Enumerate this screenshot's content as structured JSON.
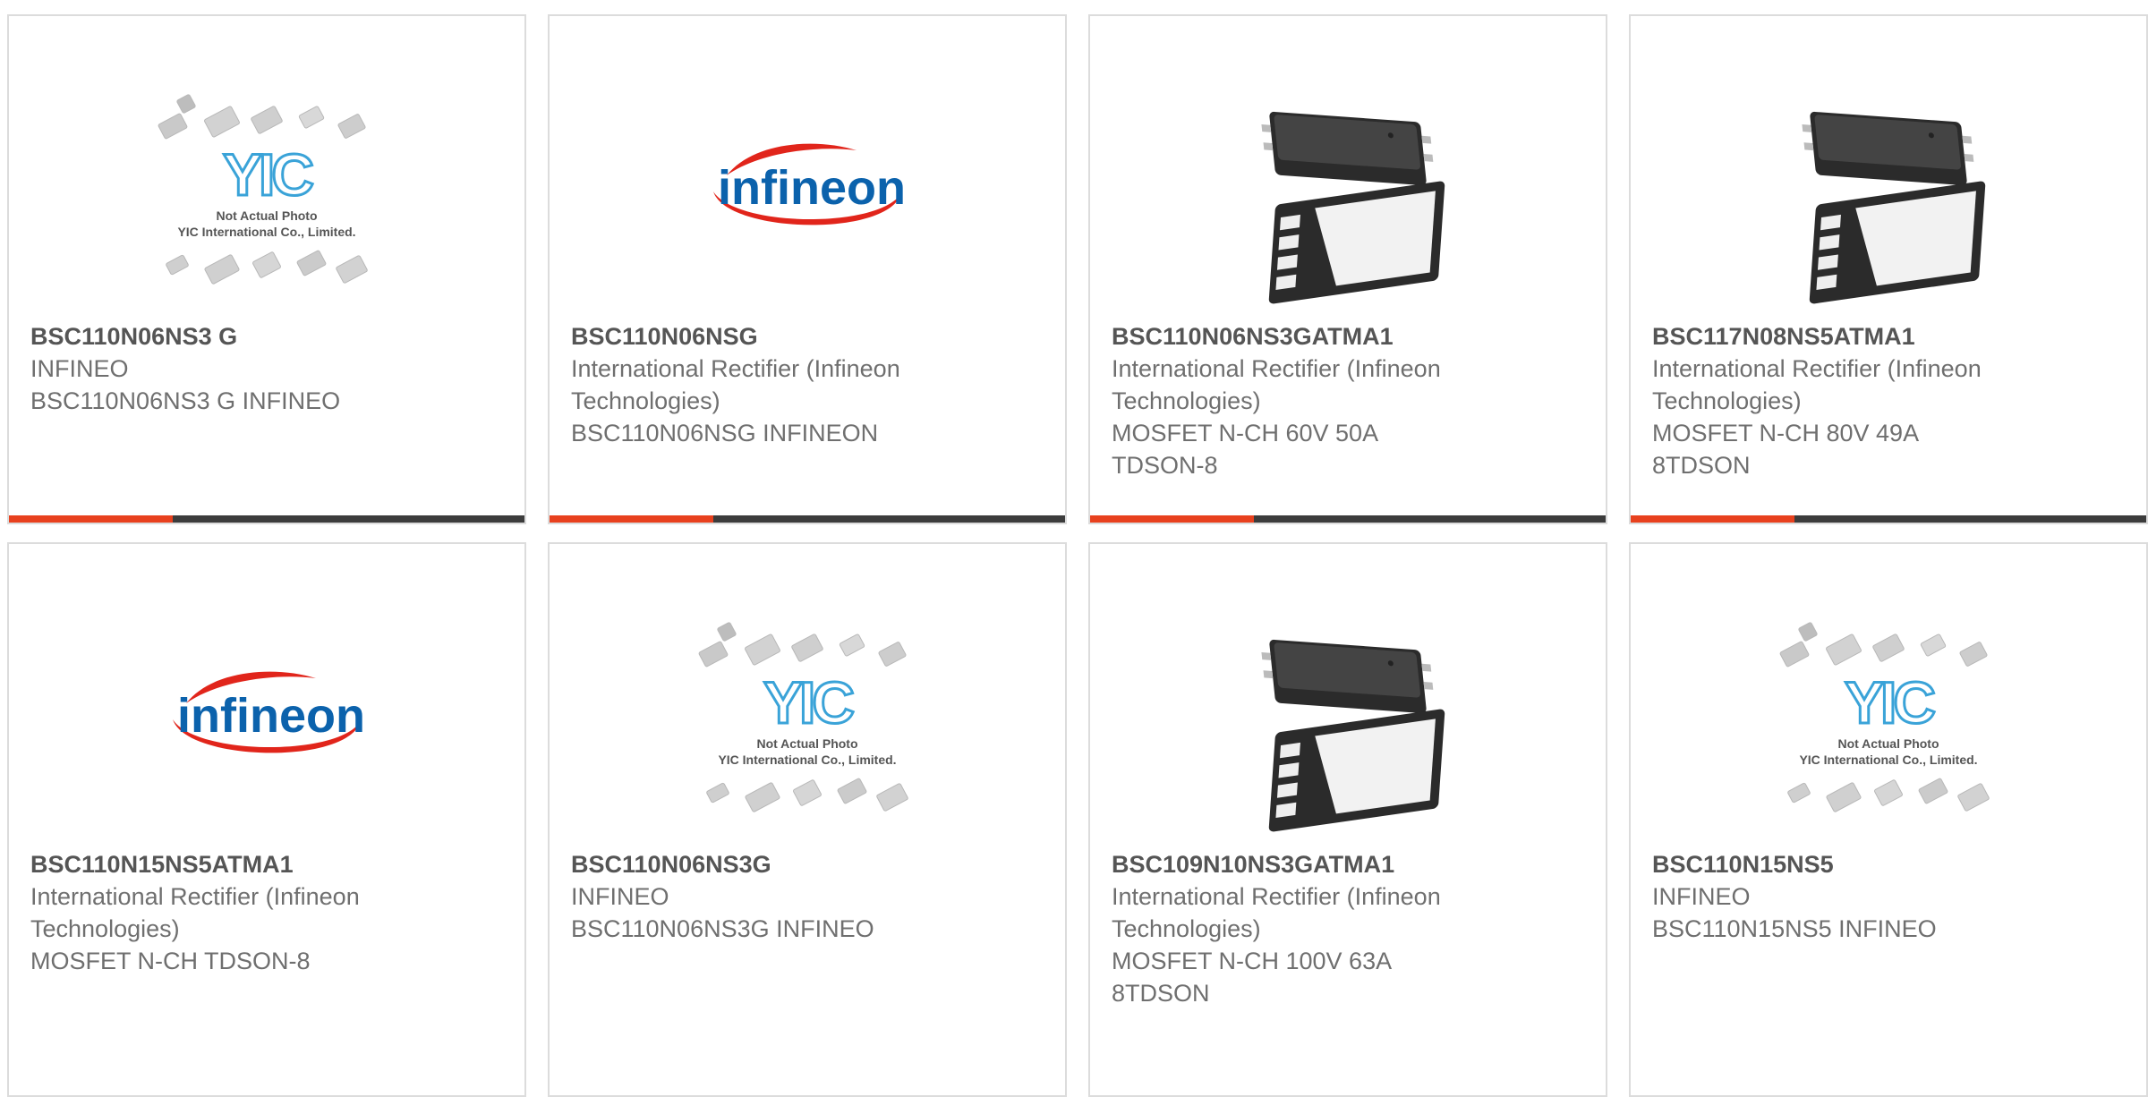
{
  "colors": {
    "accent": "#e8411e",
    "bar_dark": "#3c3c3c",
    "card_border": "#dcdcdc",
    "part_text": "#555555",
    "body_text": "#6f6f6f"
  },
  "products": [
    {
      "part": "BSC110N06NS3 G",
      "lines": [
        "INFINEO",
        "BSC110N06NS3 G INFINEO"
      ],
      "image": "yic-placeholder",
      "placeholder_text": [
        "Not Actual Photo",
        "YIC International Co., Limited."
      ],
      "logo_text": "YIC"
    },
    {
      "part": "BSC110N06NSG",
      "lines": [
        "International Rectifier (Infineon",
        "Technologies)",
        "BSC110N06NSG INFINEON"
      ],
      "image": "infineon-logo",
      "logo_text": "infineon"
    },
    {
      "part": "BSC110N06NS3GATMA1",
      "lines": [
        "International Rectifier (Infineon",
        "Technologies)",
        "MOSFET N-CH 60V 50A",
        "TDSON-8"
      ],
      "image": "tdson-package"
    },
    {
      "part": "BSC117N08NS5ATMA1",
      "lines": [
        "International Rectifier (Infineon",
        "Technologies)",
        "MOSFET N-CH 80V 49A",
        "8TDSON"
      ],
      "image": "tdson-package"
    },
    {
      "part": "BSC110N15NS5ATMA1",
      "lines": [
        "International Rectifier (Infineon",
        "Technologies)",
        "MOSFET N-CH TDSON-8"
      ],
      "image": "infineon-logo",
      "logo_text": "infineon"
    },
    {
      "part": "BSC110N06NS3G",
      "lines": [
        "INFINEO",
        "BSC110N06NS3G INFINEO"
      ],
      "image": "yic-placeholder",
      "placeholder_text": [
        "Not Actual Photo",
        "YIC International Co., Limited."
      ],
      "logo_text": "YIC"
    },
    {
      "part": "BSC109N10NS3GATMA1",
      "lines": [
        "International Rectifier (Infineon",
        "Technologies)",
        "MOSFET N-CH 100V 63A",
        "8TDSON"
      ],
      "image": "tdson-package"
    },
    {
      "part": "BSC110N15NS5",
      "lines": [
        "INFINEO",
        "BSC110N15NS5 INFINEO"
      ],
      "image": "yic-placeholder",
      "placeholder_text": [
        "Not Actual Photo",
        "YIC International Co., Limited."
      ],
      "logo_text": "YIC"
    }
  ]
}
